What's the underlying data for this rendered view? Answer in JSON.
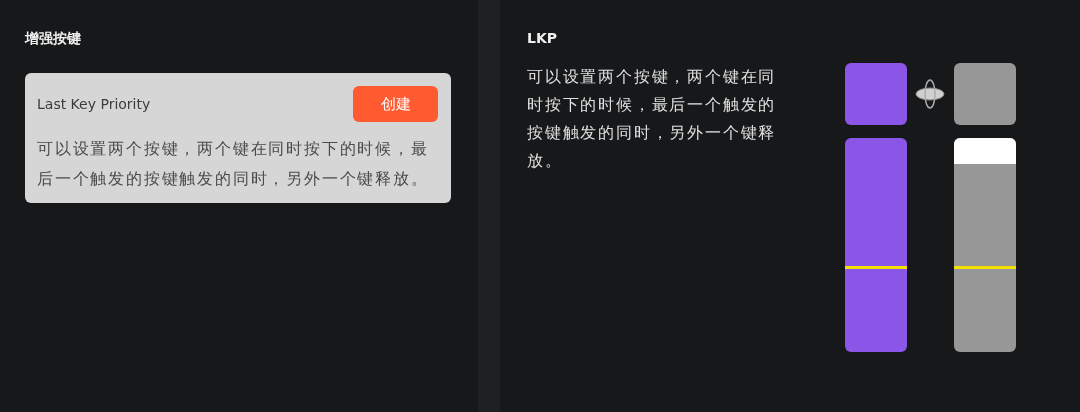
{
  "enhanced_keys": {
    "title": "增强按键",
    "card": {
      "name": "Last Key Priority",
      "button": "创建",
      "description": "可以设置两个按键，两个键在同时按下的时候，最后一个触发的按键触发的同时，另外一个键释放。"
    }
  },
  "detail": {
    "title": "LKP",
    "description": "可以设置两个按键，两个键在同时按下的时候，最后一个触发的按键触发的同时，另外一个键释放。",
    "keys": [
      {
        "pressed": true
      },
      {
        "pressed": false
      }
    ]
  }
}
